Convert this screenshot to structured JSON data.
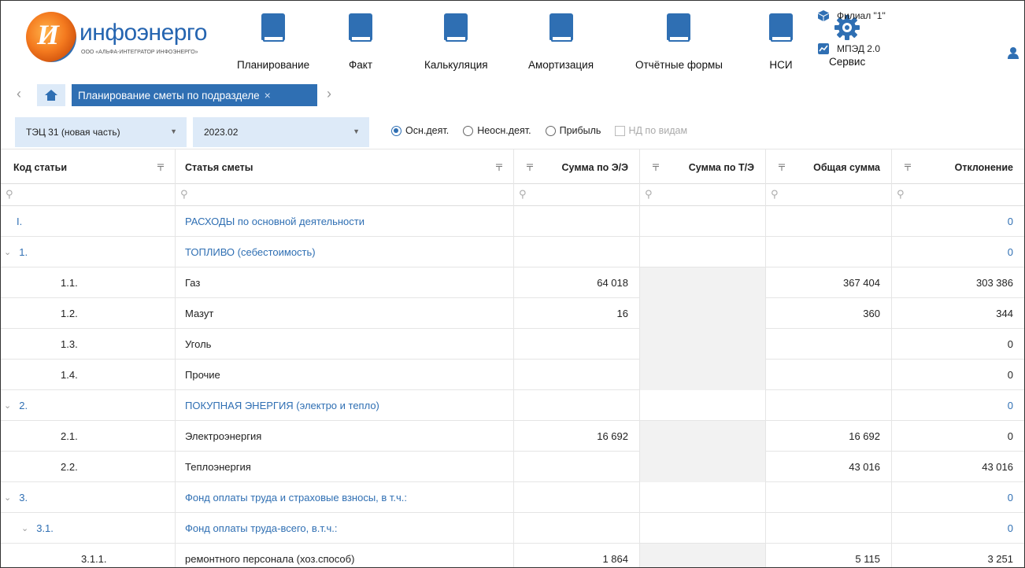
{
  "header": {
    "logo": {
      "title": "инфоэнерго",
      "subtitle": "ООО «АЛЬФА-ИНТЕГРАТОР ИНФОЭНЕРГО»"
    },
    "nav": [
      {
        "label": "Планирование",
        "icon": "book-icon"
      },
      {
        "label": "Факт",
        "icon": "book-icon"
      },
      {
        "label": "Калькуляция",
        "icon": "book-icon"
      },
      {
        "label": "Амортизация",
        "icon": "book-icon"
      },
      {
        "label": "Отчётные формы",
        "icon": "book-icon"
      },
      {
        "label": "НСИ",
        "icon": "book-icon"
      },
      {
        "label": "Сервис",
        "icon": "gear-icon"
      }
    ],
    "branch": "Филиал \"1\"",
    "app": "МПЭД 2.0"
  },
  "tabs": {
    "active_label": "Планирование сметы по подразделе",
    "close": "×"
  },
  "filters": {
    "department": "ТЭЦ 31 (новая часть)",
    "period": "2023.02",
    "radios": [
      {
        "label": "Осн.деят.",
        "checked": true
      },
      {
        "label": "Неосн.деят.",
        "checked": false
      },
      {
        "label": "Прибыль",
        "checked": false
      }
    ],
    "checkbox_label": "НД по видам"
  },
  "table": {
    "columns": [
      "Код статьи",
      "Статья сметы",
      "Сумма по Э/Э",
      "Сумма по Т/Э",
      "Общая сумма",
      "Отклонение"
    ],
    "rows": [
      {
        "code": "I.",
        "name": "РАСХОДЫ по основной деятельности",
        "ee": "",
        "te": "",
        "total": "",
        "dev": "0",
        "group": true,
        "level": 0,
        "expand": false
      },
      {
        "code": "1.",
        "name": "ТОПЛИВО (себестоимость)",
        "ee": "",
        "te": "",
        "total": "",
        "dev": "0",
        "group": true,
        "level": 0,
        "expand": true
      },
      {
        "code": "1.1.",
        "name": "Газ",
        "ee": "64 018",
        "te": "",
        "total": "367 404",
        "dev": "303 386",
        "group": false,
        "level": 1
      },
      {
        "code": "1.2.",
        "name": "Мазут",
        "ee": "16",
        "te": "",
        "total": "360",
        "dev": "344",
        "group": false,
        "level": 1
      },
      {
        "code": "1.3.",
        "name": "Уголь",
        "ee": "",
        "te": "",
        "total": "",
        "dev": "0",
        "group": false,
        "level": 1
      },
      {
        "code": "1.4.",
        "name": "Прочие",
        "ee": "",
        "te": "",
        "total": "",
        "dev": "0",
        "group": false,
        "level": 1
      },
      {
        "code": "2.",
        "name": "ПОКУПНАЯ ЭНЕРГИЯ (электро и тепло)",
        "ee": "",
        "te": "",
        "total": "",
        "dev": "0",
        "group": true,
        "level": 0,
        "expand": true
      },
      {
        "code": "2.1.",
        "name": "Электроэнергия",
        "ee": "16 692",
        "te": "",
        "total": "16 692",
        "dev": "0",
        "group": false,
        "level": 1
      },
      {
        "code": "2.2.",
        "name": "Теплоэнергия",
        "ee": "",
        "te": "",
        "total": "43 016",
        "dev": "43 016",
        "group": false,
        "level": 1
      },
      {
        "code": "3.",
        "name": "Фонд оплаты труда и страховые взносы, в т.ч.:",
        "ee": "",
        "te": "",
        "total": "",
        "dev": "0",
        "group": true,
        "level": 0,
        "expand": true
      },
      {
        "code": "3.1.",
        "name": "Фонд оплаты труда-всего, в.т.ч.:",
        "ee": "",
        "te": "",
        "total": "",
        "dev": "0",
        "group": true,
        "level": 1,
        "expand": true
      },
      {
        "code": "3.1.1.",
        "name": "ремонтного персонала (хоз.способ)",
        "ee": "1 864",
        "te": "",
        "total": "5 115",
        "dev": "3 251",
        "group": false,
        "level": 2
      }
    ]
  },
  "colors": {
    "accent": "#2f6fb3",
    "tab_bg": "#ddeaf8",
    "shade": "#f2f2f2"
  }
}
